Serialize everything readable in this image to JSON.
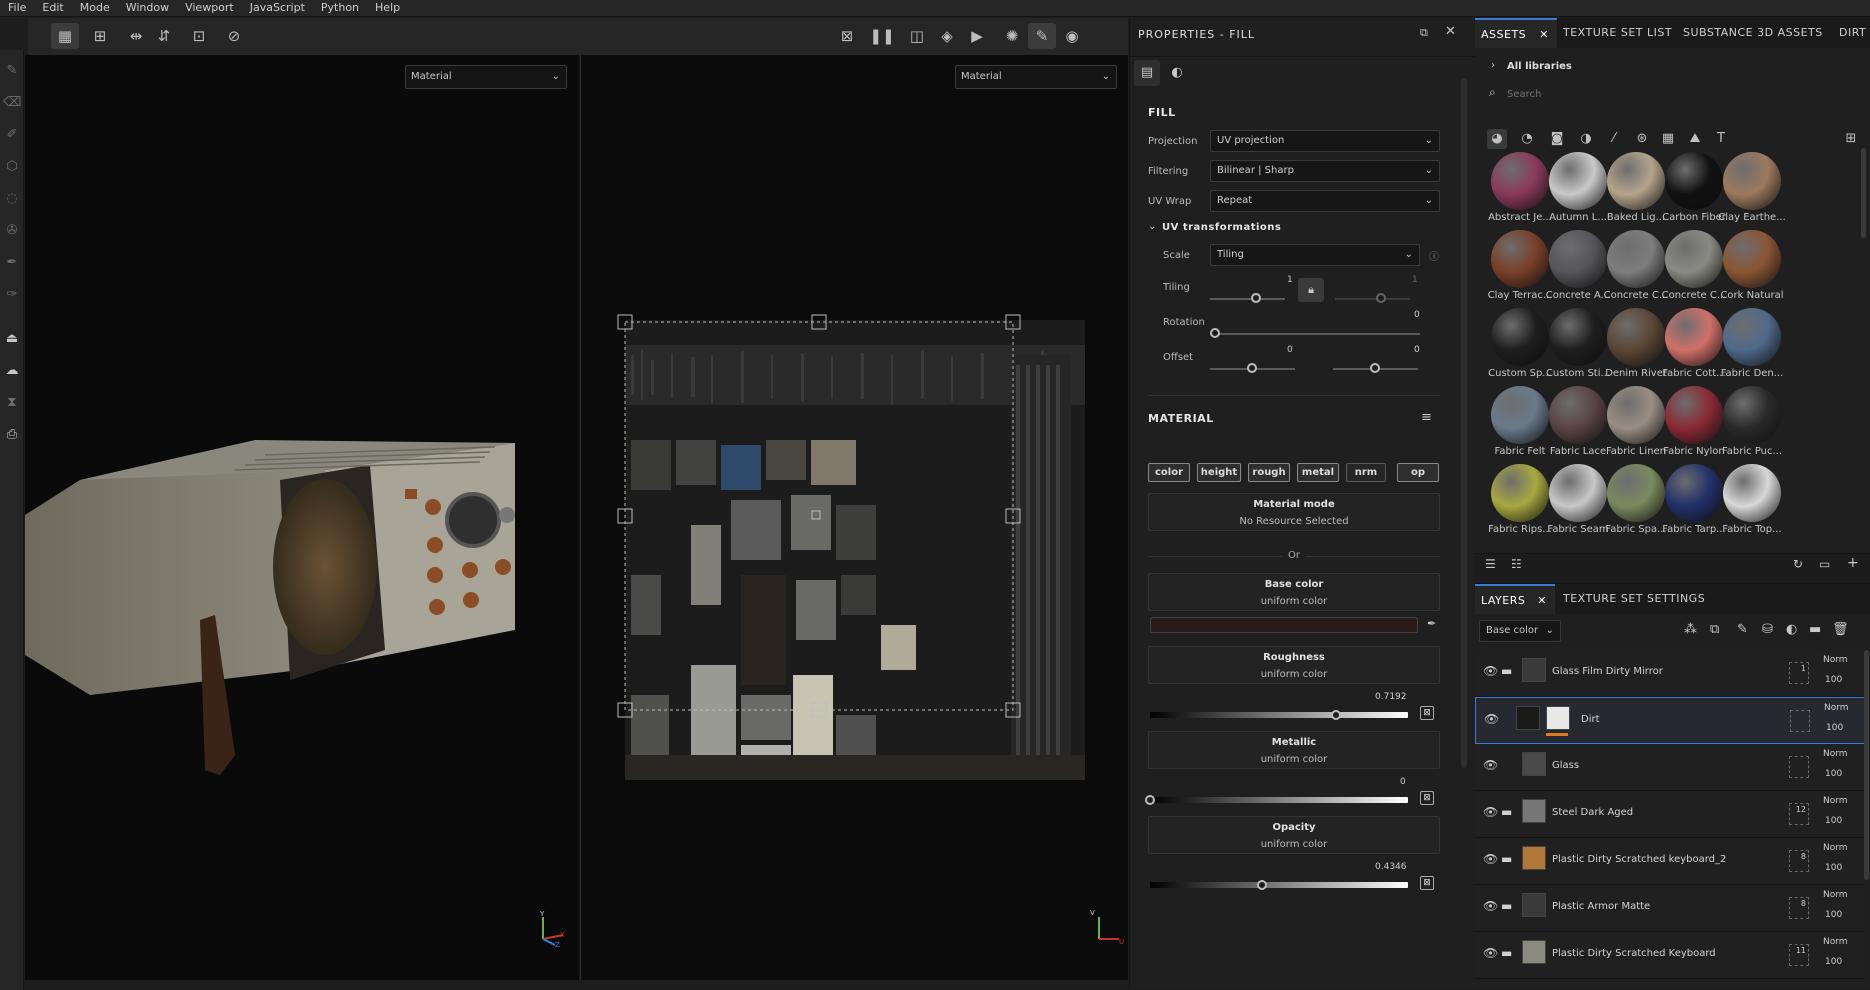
{
  "menu": [
    "File",
    "Edit",
    "Mode",
    "Window",
    "Viewport",
    "JavaScript",
    "Python",
    "Help"
  ],
  "viewport": {
    "left_mode": "Material",
    "right_mode": "Material",
    "axis_left": {
      "y": "Y",
      "x": "X",
      "z": "Z"
    },
    "axis_right": {
      "v": "V",
      "u": "U"
    }
  },
  "properties": {
    "title": "PROPERTIES - FILL",
    "fill_section": "FILL",
    "projection_label": "Projection",
    "projection_value": "UV projection",
    "filtering_label": "Filtering",
    "filtering_value": "Bilinear | Sharp",
    "uvwrap_label": "UV Wrap",
    "uvwrap_value": "Repeat",
    "uvtrans_title": "UV transformations",
    "scale_label": "Scale",
    "scale_value": "Tiling",
    "tiling_label": "Tiling",
    "tiling_value": "1",
    "tiling_value2": "1",
    "rotation_label": "Rotation",
    "rotation_value": "0",
    "offset_label": "Offset",
    "offset_u": "0",
    "offset_v": "0",
    "material_title": "MATERIAL",
    "channels": [
      "color",
      "height",
      "rough",
      "metal",
      "nrm",
      "op"
    ],
    "material_mode_title": "Material mode",
    "material_mode_sub": "No Resource Selected",
    "or_label": "Or",
    "base_color_title": "Base color",
    "base_color_sub": "uniform color",
    "base_color_hex": "#2a1a1a",
    "roughness_title": "Roughness",
    "roughness_sub": "uniform color",
    "roughness_value": "0.7192",
    "roughness_fraction": 0.7192,
    "metallic_title": "Metallic",
    "metallic_sub": "uniform color",
    "metallic_value": "0",
    "metallic_fraction": 0,
    "opacity_title": "Opacity",
    "opacity_sub": "uniform color",
    "opacity_value": "0.4346",
    "opacity_fraction": 0.4346
  },
  "assets": {
    "tabs": [
      "ASSETS",
      "TEXTURE SET LIST",
      "SUBSTANCE 3D ASSETS",
      "DIRT"
    ],
    "breadcrumb": "All libraries",
    "search_placeholder": "Search",
    "items": [
      {
        "label": "Abstract Je...",
        "color": "#8a3a5a"
      },
      {
        "label": "Autumn L...",
        "color": "#c9c9c9"
      },
      {
        "label": "Baked Lig...",
        "color": "#b5a48c"
      },
      {
        "label": "Carbon Fiber",
        "color": "#111111"
      },
      {
        "label": "Clay Earthe...",
        "color": "#9c7a5e"
      },
      {
        "label": "Clay Terrac...",
        "color": "#7a3f28"
      },
      {
        "label": "Concrete A...",
        "color": "#55555a"
      },
      {
        "label": "Concrete C...",
        "color": "#7d7d7d"
      },
      {
        "label": "Concrete C...",
        "color": "#8a8a84"
      },
      {
        "label": "Cork Natural",
        "color": "#8a5634"
      },
      {
        "label": "Custom Sp...",
        "color": "#1e1e1e"
      },
      {
        "label": "Custom Sti...",
        "color": "#1e1e1e"
      },
      {
        "label": "Denim Rivet",
        "color": "#5a4636"
      },
      {
        "label": "Fabric Cott...",
        "color": "#d0706a"
      },
      {
        "label": "Fabric Den...",
        "color": "#4f6a8a"
      },
      {
        "label": "Fabric Felt",
        "color": "#6a7a8a"
      },
      {
        "label": "Fabric Lace",
        "color": "#5a4444"
      },
      {
        "label": "Fabric Linen",
        "color": "#9a8e84"
      },
      {
        "label": "Fabric Nylon",
        "color": "#8a2a36"
      },
      {
        "label": "Fabric Puc...",
        "color": "#2a2a2a"
      },
      {
        "label": "Fabric Rips...",
        "color": "#a8a840"
      },
      {
        "label": "Fabric Seam",
        "color": "#c8c8c8"
      },
      {
        "label": "Fabric Spa...",
        "color": "#7a8a5e"
      },
      {
        "label": "Fabric Tarp...",
        "color": "#23306a"
      },
      {
        "label": "Fabric Top...",
        "color": "#d8d8d8"
      }
    ]
  },
  "layers": {
    "tabs": [
      "LAYERS",
      "TEXTURE SET SETTINGS"
    ],
    "channel_select": "Base color",
    "rows": [
      {
        "name": "Glass Film Dirty Mirror",
        "blend": "Norm",
        "opacity": "100",
        "count": "1",
        "folder": true,
        "thumb": "#3a3a3a"
      },
      {
        "name": "Dirt",
        "blend": "Norm",
        "opacity": "100",
        "count": "",
        "folder": false,
        "thumb": "#1a1a1a"
      },
      {
        "name": "Glass",
        "blend": "Norm",
        "opacity": "100",
        "count": "",
        "folder": false,
        "thumb": "#4a4a4a"
      },
      {
        "name": "Steel Dark Aged",
        "blend": "Norm",
        "opacity": "100",
        "count": "12",
        "folder": true,
        "thumb": "#777777"
      },
      {
        "name": "Plastic Dirty Scratched keyboard_2",
        "blend": "Norm",
        "opacity": "100",
        "count": "8",
        "folder": true,
        "thumb": "#b0763a"
      },
      {
        "name": "Plastic Armor Matte",
        "blend": "Norm",
        "opacity": "100",
        "count": "8",
        "folder": true,
        "thumb": "#3a3a3a"
      },
      {
        "name": "Plastic Dirty Scratched Keyboard",
        "blend": "Norm",
        "opacity": "100",
        "count": "11",
        "folder": true,
        "thumb": "#8a8a80"
      }
    ]
  }
}
